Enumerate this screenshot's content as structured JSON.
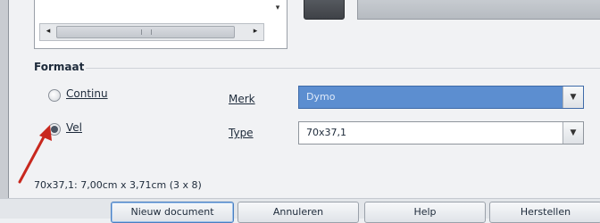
{
  "section": {
    "title": "Formaat"
  },
  "options": {
    "continuous": {
      "label": "Continu",
      "checked": false
    },
    "sheet": {
      "label": "Vel",
      "checked": true
    }
  },
  "fields": {
    "brand": {
      "label": "Merk",
      "value": "Dymo"
    },
    "type": {
      "label": "Type",
      "value": "70x37,1"
    }
  },
  "size_text": "70x37,1: 7,00cm x 3,71cm (3 x 8)",
  "buttons": {
    "new_document": "Nieuw document",
    "cancel": "Annuleren",
    "help": "Help",
    "reset": "Herstellen"
  },
  "icons": {
    "scroll_left": "◂",
    "scroll_right": "▸",
    "scroll_down": "▾",
    "dropdown": "▼"
  },
  "colors": {
    "highlight": "#5c8ed0",
    "arrow": "#c8281e"
  }
}
